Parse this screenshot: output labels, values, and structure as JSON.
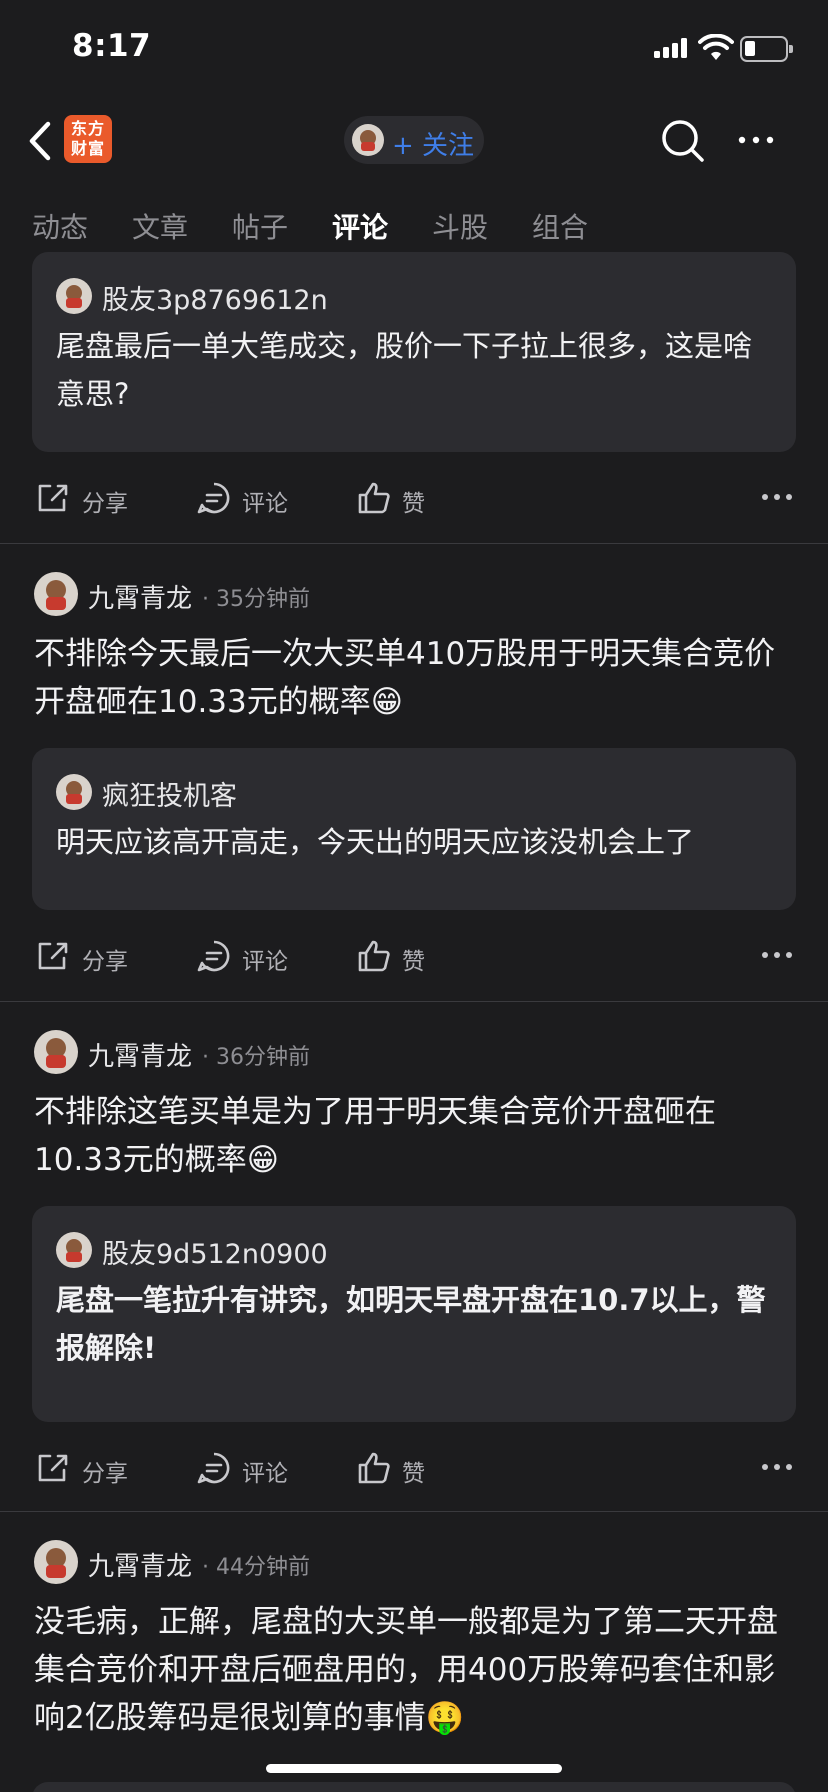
{
  "status_bar": {
    "time": "8:17",
    "battery_level": 0.25
  },
  "nav": {
    "logo_text_line1": "东方",
    "logo_text_line2": "财富",
    "follow_label": "+ 关注",
    "brand_color": "#ea5a2b",
    "accent_color": "#3f7ee8",
    "icons": [
      "back-chevron-icon",
      "search-icon",
      "more-icon"
    ]
  },
  "tabs": [
    {
      "label": "动态"
    },
    {
      "label": "文章"
    },
    {
      "label": "帖子"
    },
    {
      "label": "评论",
      "active": true
    },
    {
      "label": "斗股"
    },
    {
      "label": "组合"
    }
  ],
  "actions": {
    "share": "分享",
    "comment": "评论",
    "like": "赞"
  },
  "posts": [
    {
      "quote": {
        "author": "股友3p8769612n",
        "text": "尾盘最后一单大笔成交，股价一下子拉上很多，这是啥意思?"
      }
    },
    {
      "author": "九霄青龙",
      "time": "35分钟前",
      "text": "不排除今天最后一次大买单410万股用于明天集合竞价开盘砸在10.33元的概率😁",
      "quote": {
        "author": "疯狂投机客",
        "text": "明天应该高开高走，今天出的明天应该没机会上了"
      }
    },
    {
      "author": "九霄青龙",
      "time": "36分钟前",
      "text": "不排除这笔买单是为了用于明天集合竞价开盘砸在10.33元的概率😁",
      "quote": {
        "author": "股友9d512n0900",
        "text": "尾盘一笔拉升有讲究，如明天早盘开盘在10.7以上，警报解除!"
      }
    },
    {
      "author": "九霄青龙",
      "time": "44分钟前",
      "text": "没毛病，正解，尾盘的大买单一般都是为了第二天开盘集合竞价和开盘后砸盘用的，用400万股筹码套住和影响2亿股筹码是很划算的事情🤑"
    }
  ]
}
